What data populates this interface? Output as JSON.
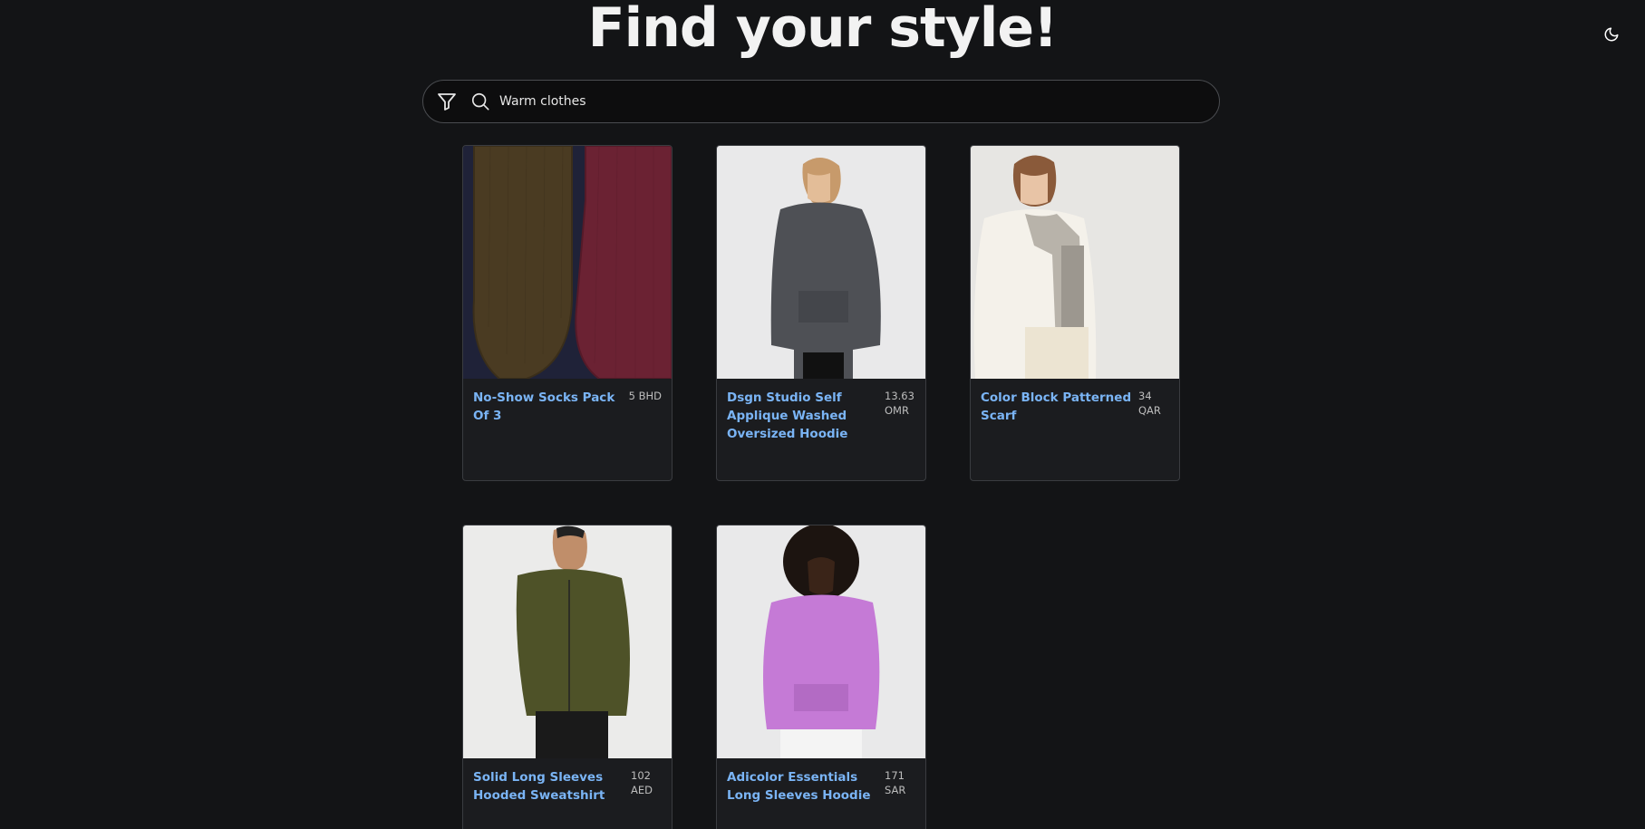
{
  "header": {
    "title": "Find your style!",
    "theme_toggle_icon": "moon-icon"
  },
  "search": {
    "filter_icon": "filter-icon",
    "search_icon": "search-icon",
    "value": "Warm clothes"
  },
  "products": [
    {
      "name": "No-Show Socks Pack Of 3",
      "price": "5 BHD"
    },
    {
      "name": "Dsgn Studio Self Applique Washed Oversized Hoodie",
      "price": "13.63 OMR"
    },
    {
      "name": "Color Block Patterned Scarf",
      "price": "34 QAR"
    },
    {
      "name": "Solid Long Sleeves Hooded Sweatshirt",
      "price": "102 AED"
    },
    {
      "name": "Adicolor Essentials Long Sleeves Hoodie",
      "price": "171 SAR"
    }
  ],
  "colors": {
    "background": "#131416",
    "card": "#1b1c1f",
    "link": "#7ab4f5"
  }
}
